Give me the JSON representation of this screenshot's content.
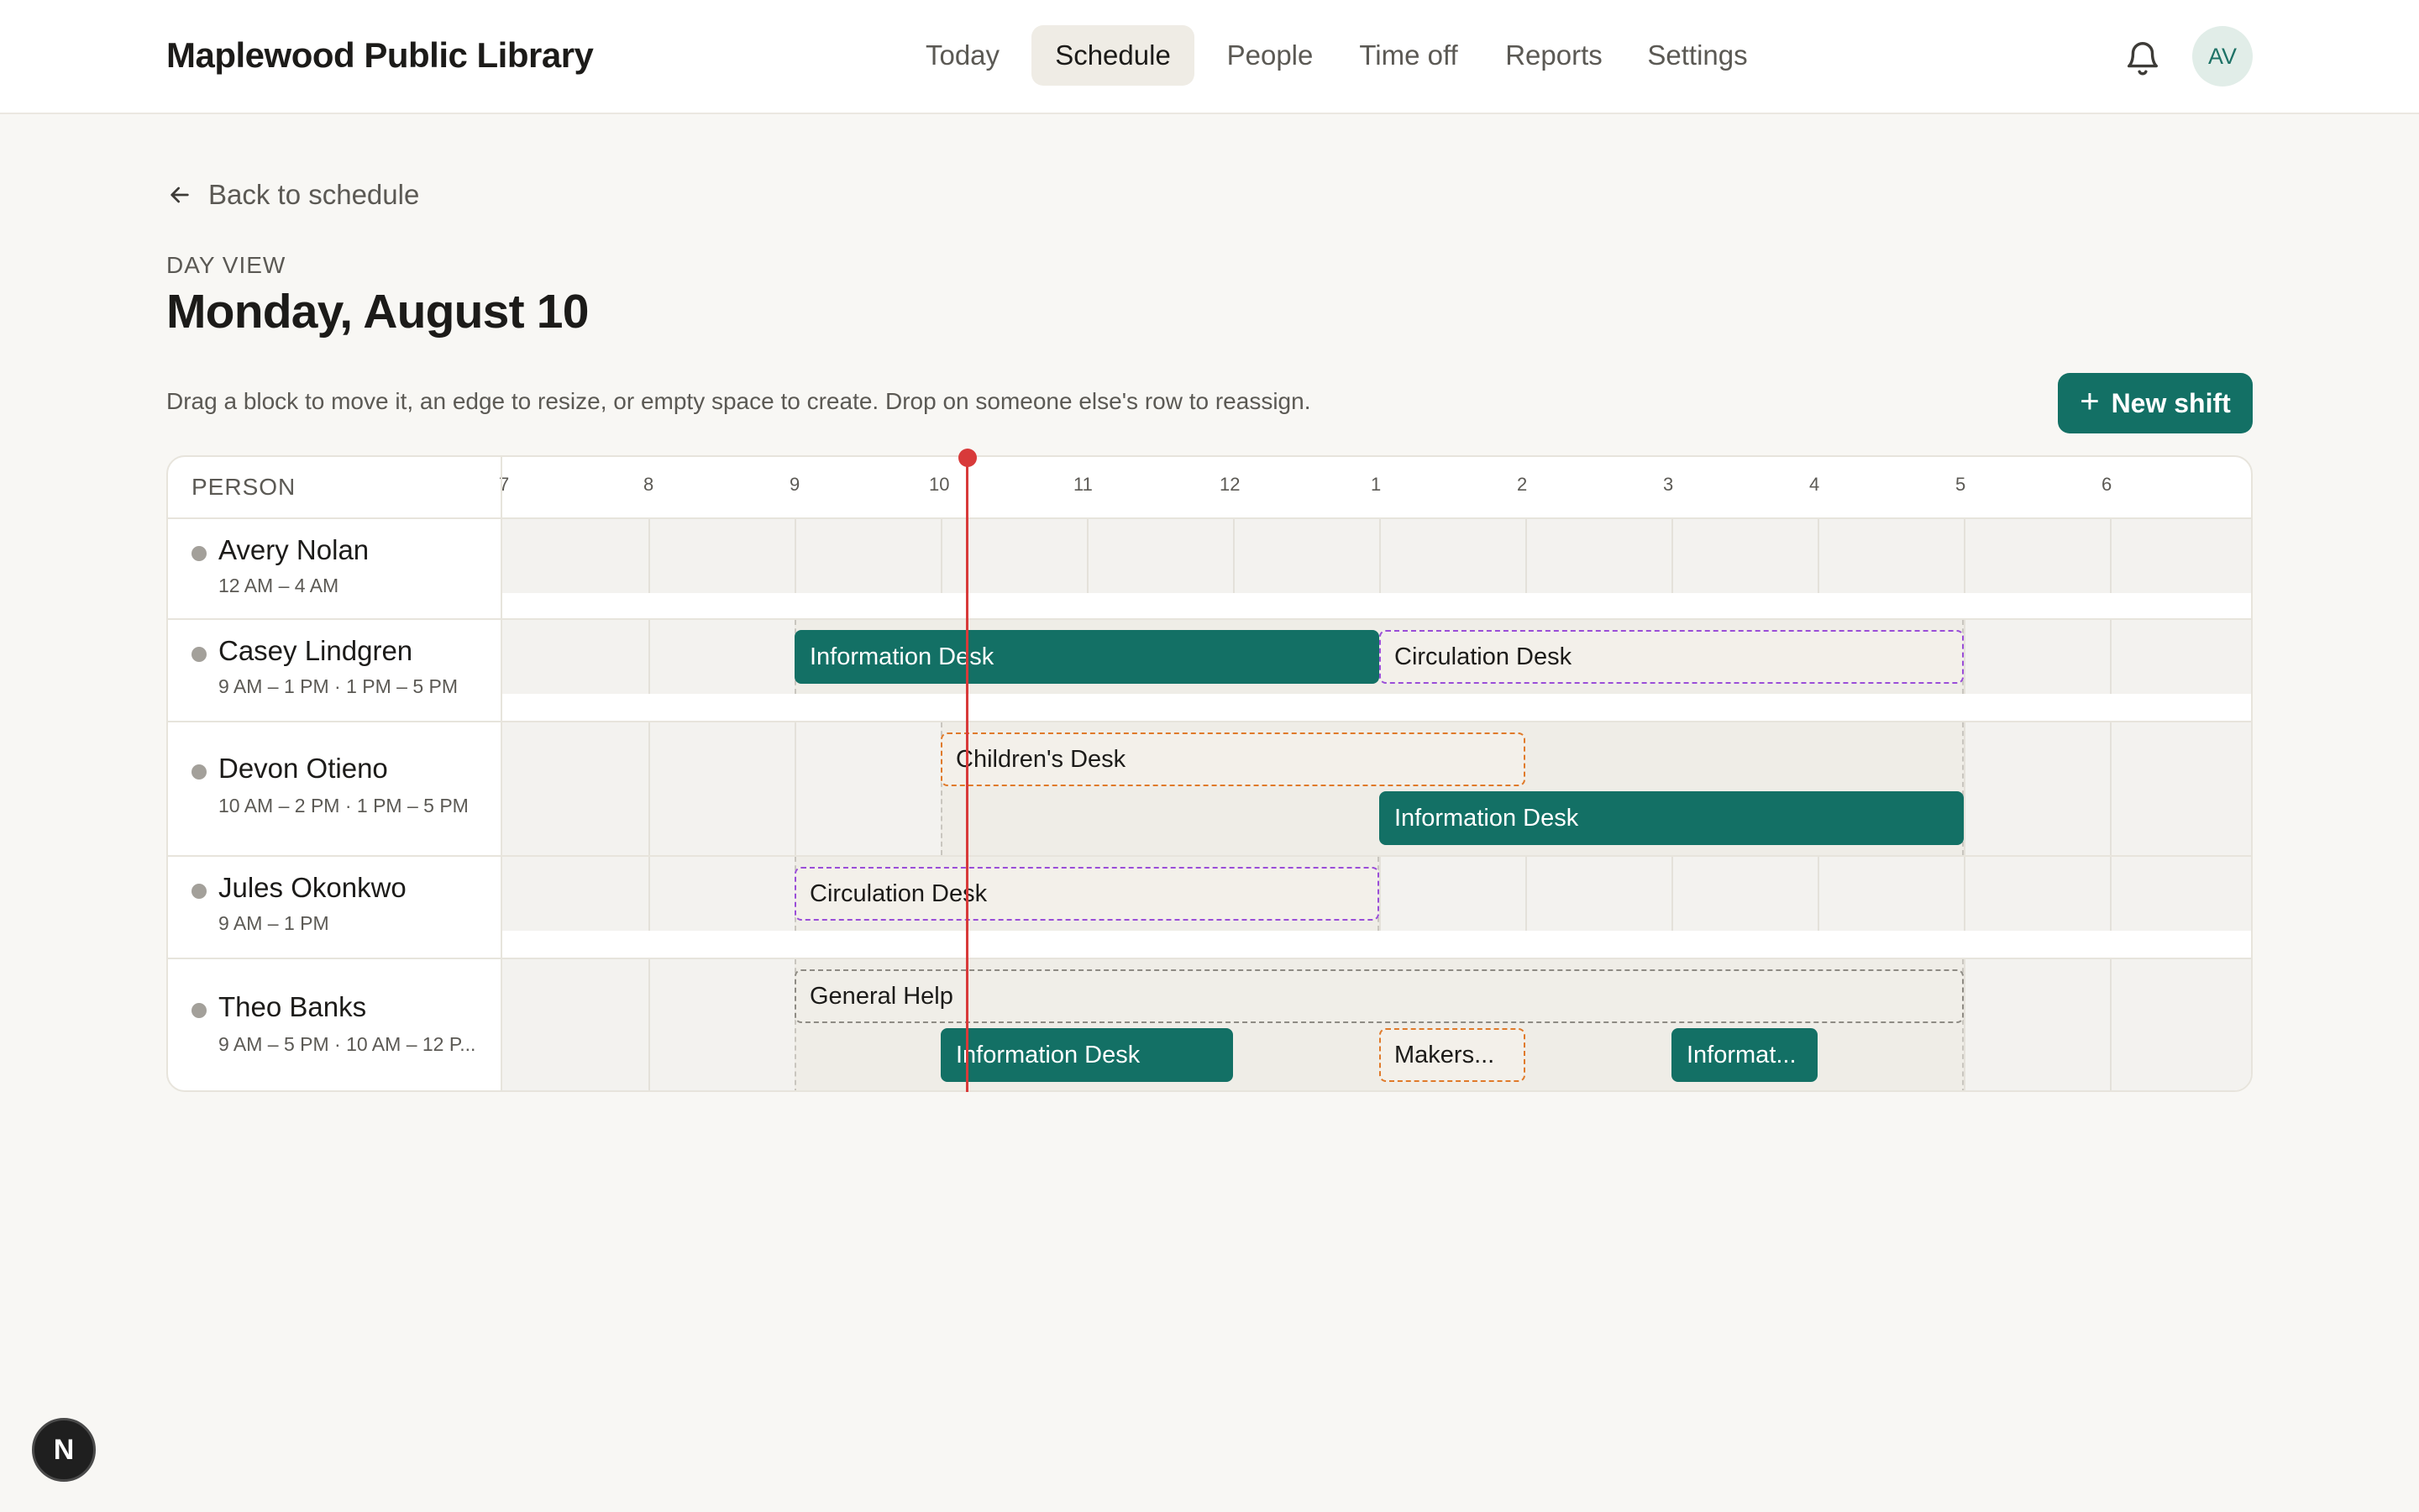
{
  "brand": "Maplewood Public Library",
  "nav": [
    {
      "label": "Today",
      "active": false
    },
    {
      "label": "Schedule",
      "active": true
    },
    {
      "label": "People",
      "active": false
    },
    {
      "label": "Time off",
      "active": false
    },
    {
      "label": "Reports",
      "active": false
    },
    {
      "label": "Settings",
      "active": false
    }
  ],
  "user": {
    "initials": "AV"
  },
  "icons": {
    "notifications": "bell-icon",
    "back": "arrow-left-icon",
    "add": "plus-icon"
  },
  "page": {
    "back_label": "Back to schedule",
    "eyebrow": "DAY VIEW",
    "title": "Monday, August 10",
    "hint": "Drag a block to move it, an edge to resize, or empty space to create. Drop on someone else's row to reassign.",
    "new_shift_label": "New shift"
  },
  "grid": {
    "person_header": "PERSON",
    "hour_labels": [
      "7",
      "8",
      "9",
      "10",
      "11",
      "12",
      "1",
      "2",
      "3",
      "4",
      "5",
      "6"
    ],
    "now_time": "10:12"
  },
  "people": [
    {
      "name": "Avery Nolan",
      "hours": "12 AM – 4 AM",
      "shifts": []
    },
    {
      "name": "Casey Lindgren",
      "hours": "9 AM – 1 PM · 1 PM – 5 PM",
      "shifts": [
        {
          "label": "Information Desk",
          "style": "solid",
          "start": "9:00",
          "end": "13:00"
        },
        {
          "label": "Circulation Desk",
          "style": "dashed-purple",
          "start": "13:00",
          "end": "17:00"
        }
      ]
    },
    {
      "name": "Devon Otieno",
      "hours": "10 AM – 2 PM · 1 PM – 5 PM",
      "shifts": [
        {
          "label": "Children's Desk",
          "style": "dashed-orange",
          "start": "10:00",
          "end": "14:00"
        },
        {
          "label": "Information Desk",
          "style": "solid",
          "start": "13:00",
          "end": "17:00"
        }
      ]
    },
    {
      "name": "Jules Okonkwo",
      "hours": "9 AM – 1 PM",
      "shifts": [
        {
          "label": "Circulation Desk",
          "style": "dashed-purple",
          "start": "9:00",
          "end": "13:00"
        }
      ]
    },
    {
      "name": "Theo Banks",
      "hours": "9 AM – 5 PM · 10 AM – 12 P...",
      "shifts": [
        {
          "label": "General Help",
          "style": "dashed-gray",
          "start": "9:00",
          "end": "17:00"
        },
        {
          "label": "Information Desk",
          "style": "solid",
          "start": "10:00",
          "end": "12:00"
        },
        {
          "label": "Makers...",
          "style": "dashed-orange",
          "start": "13:00",
          "end": "14:00"
        },
        {
          "label": "Informat...",
          "style": "solid",
          "start": "15:00",
          "end": "16:00"
        }
      ]
    }
  ],
  "colors": {
    "accent": "#137065",
    "now_line": "#d83a3a",
    "purple_dash": "#9a4ed8",
    "orange_dash": "#e07a2a"
  },
  "devtools_badge": "N"
}
